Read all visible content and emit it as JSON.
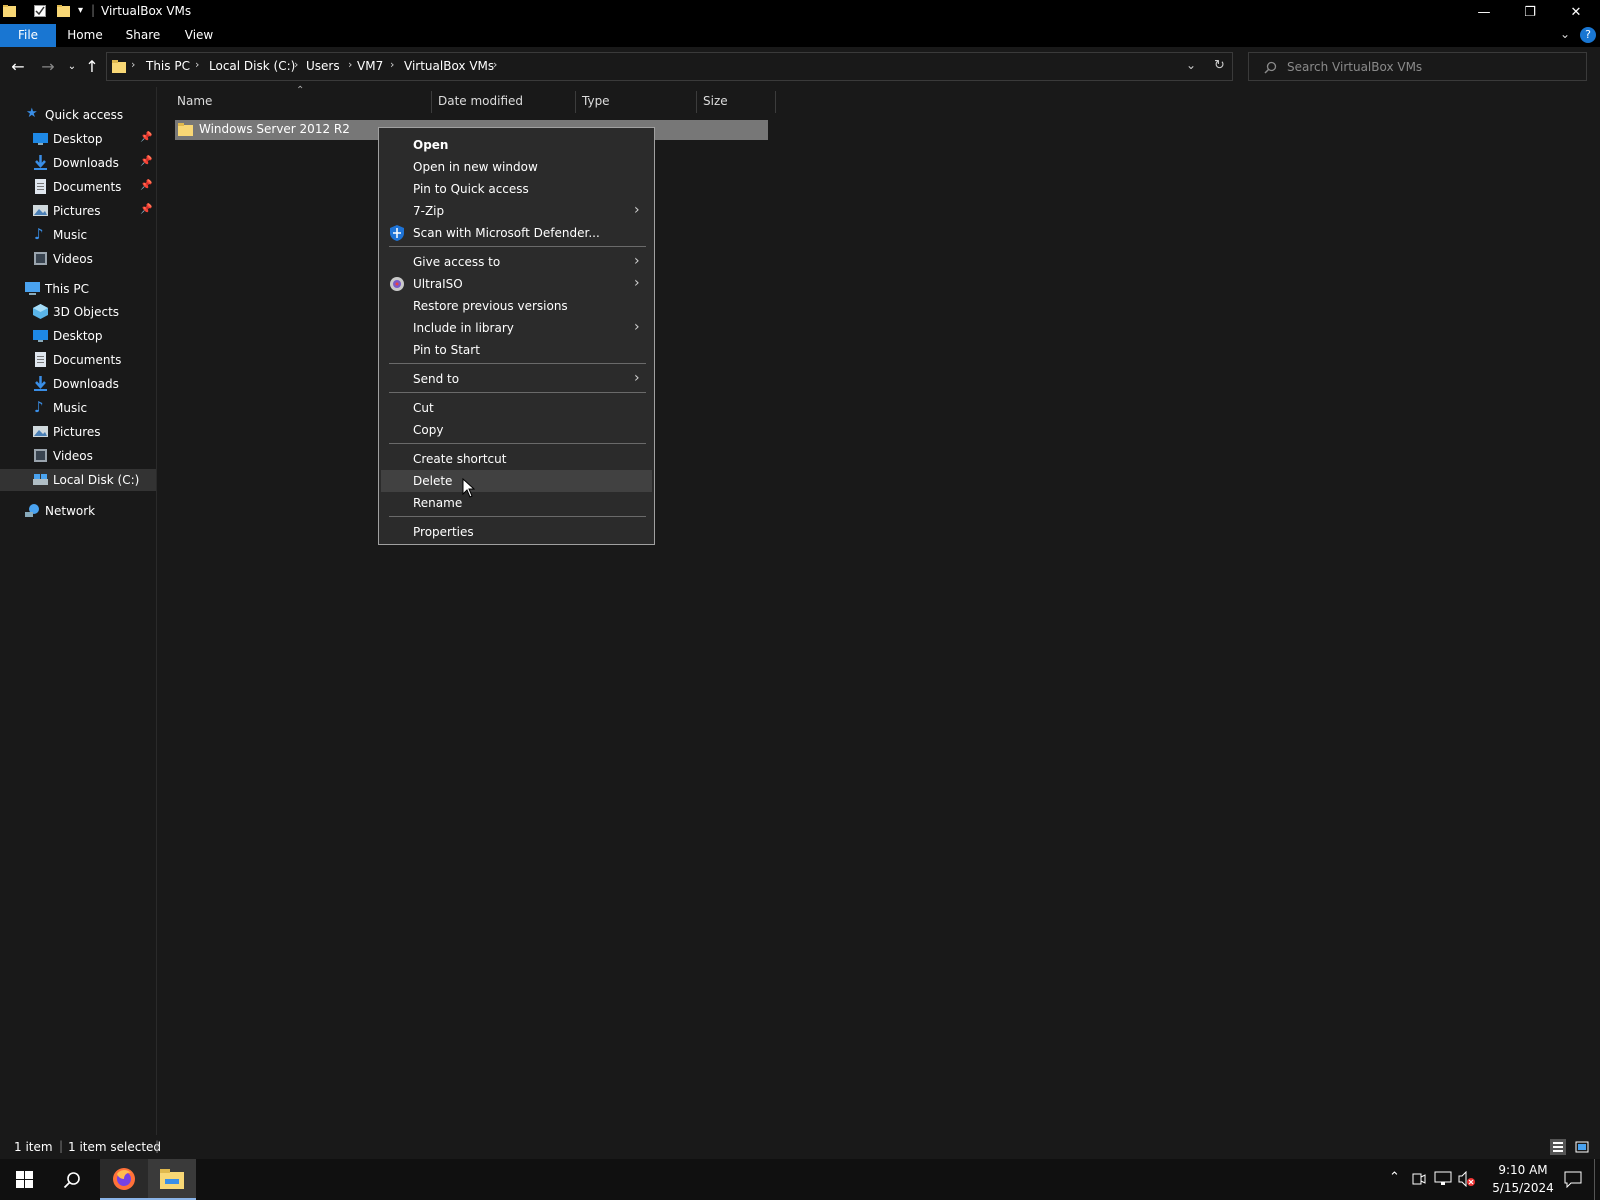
{
  "window": {
    "title": "VirtualBox VMs",
    "controls": {
      "minimize": "—",
      "restore": "❐",
      "close": "✕"
    }
  },
  "ribbon": {
    "tabs": [
      {
        "label": "File"
      },
      {
        "label": "Home"
      },
      {
        "label": "Share"
      },
      {
        "label": "View"
      }
    ],
    "help": "?"
  },
  "address": {
    "breadcrumbs": [
      "This PC",
      "Local Disk (C:)",
      "Users",
      "VM7",
      "VirtualBox VMs"
    ],
    "search_placeholder": "Search VirtualBox VMs"
  },
  "nav": {
    "quick_access": {
      "label": "Quick access",
      "items": [
        {
          "label": "Desktop",
          "icon": "desktop-icon",
          "pinned": true
        },
        {
          "label": "Downloads",
          "icon": "download-icon",
          "pinned": true
        },
        {
          "label": "Documents",
          "icon": "document-icon",
          "pinned": true
        },
        {
          "label": "Pictures",
          "icon": "picture-icon",
          "pinned": true
        },
        {
          "label": "Music",
          "icon": "music-icon",
          "pinned": false
        },
        {
          "label": "Videos",
          "icon": "video-icon",
          "pinned": false
        }
      ]
    },
    "this_pc": {
      "label": "This PC",
      "items": [
        {
          "label": "3D Objects",
          "icon": "cube-icon"
        },
        {
          "label": "Desktop",
          "icon": "desktop-icon"
        },
        {
          "label": "Documents",
          "icon": "document-icon"
        },
        {
          "label": "Downloads",
          "icon": "download-icon"
        },
        {
          "label": "Music",
          "icon": "music-icon"
        },
        {
          "label": "Pictures",
          "icon": "picture-icon"
        },
        {
          "label": "Videos",
          "icon": "video-icon"
        },
        {
          "label": "Local Disk (C:)",
          "icon": "drive-icon",
          "selected": true
        }
      ]
    },
    "network": {
      "label": "Network"
    }
  },
  "content": {
    "columns": [
      "Name",
      "Date modified",
      "Type",
      "Size"
    ],
    "files": [
      {
        "name": "Windows Server 2012 R2",
        "selected": true
      }
    ]
  },
  "context_menu": {
    "items": [
      {
        "label": "Open",
        "bold": true
      },
      {
        "label": "Open in new window"
      },
      {
        "label": "Pin to Quick access"
      },
      {
        "label": "7-Zip",
        "submenu": true
      },
      {
        "label": "Scan with Microsoft Defender...",
        "icon": "defender-shield-icon"
      },
      {
        "label": "Give access to",
        "submenu": true
      },
      {
        "label": "UltraISO",
        "submenu": true,
        "icon": "ultraiso-icon"
      },
      {
        "label": "Restore previous versions"
      },
      {
        "label": "Include in library",
        "submenu": true
      },
      {
        "label": "Pin to Start"
      },
      {
        "label": "Send to",
        "submenu": true
      },
      {
        "label": "Cut"
      },
      {
        "label": "Copy"
      },
      {
        "label": "Create shortcut"
      },
      {
        "label": "Delete",
        "hovered": true
      },
      {
        "label": "Rename"
      },
      {
        "label": "Properties"
      }
    ]
  },
  "status": {
    "item_count": "1 item",
    "selected_count": "1 item selected"
  },
  "taskbar": {
    "time": "9:10 AM",
    "date": "5/15/2024"
  },
  "colors": {
    "accent": "#1976d2",
    "background": "#191919",
    "menu_background": "#2b2b2b",
    "selection": "#777777",
    "folder": "#f8d775"
  }
}
